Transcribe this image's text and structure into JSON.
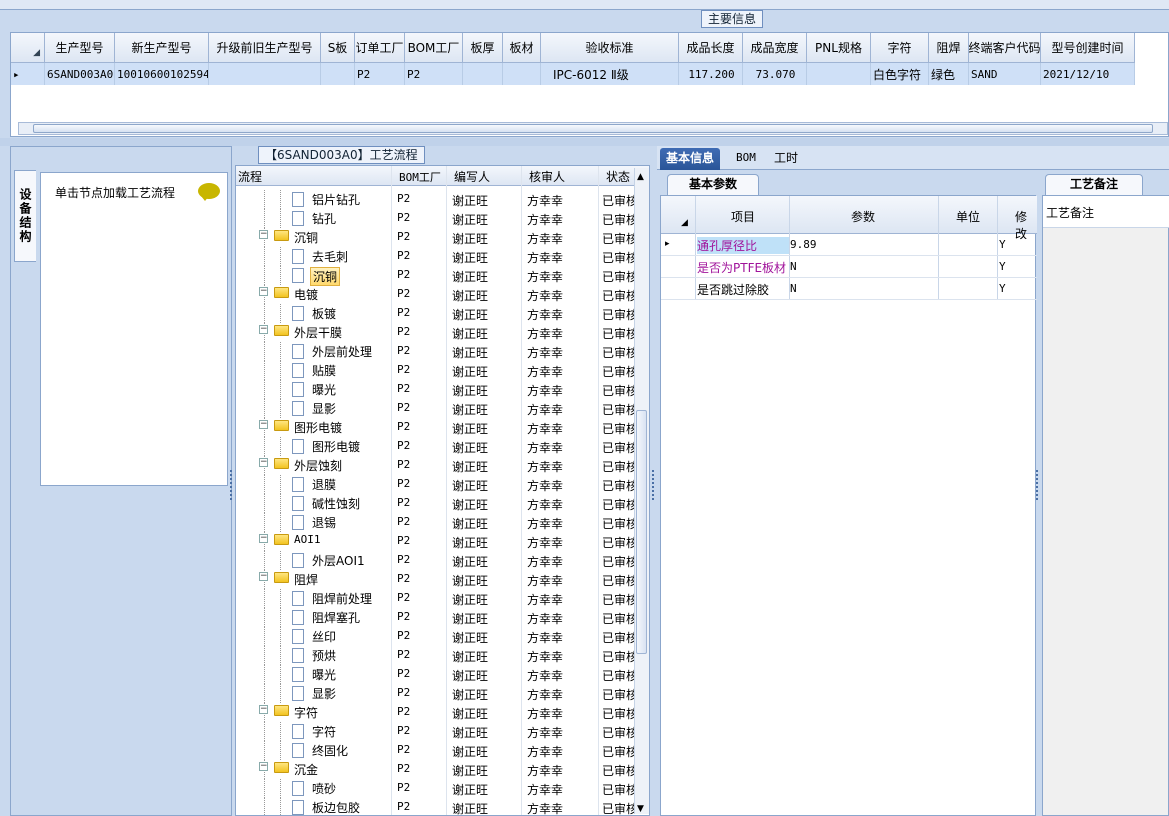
{
  "main_info": {
    "group_title": "主要信息",
    "columns": [
      "生产型号",
      "新生产型号",
      "升级前旧生产型号",
      "S板",
      "订单工厂",
      "BOM工厂",
      "板厚",
      "板材",
      "验收标准",
      "成品长度",
      "成品宽度",
      "PNL规格",
      "字符",
      "阻焊",
      "终端客户代码",
      "型号创建时间"
    ],
    "row": [
      "6SAND003A0",
      "10010600102594",
      "",
      "",
      "P2",
      "P2",
      "",
      "",
      "IPC-6012 Ⅱ级",
      "117.200",
      "73.070",
      "",
      "白色字符",
      "绿色",
      "SAND",
      "2021/12/10"
    ]
  },
  "left_panel": {
    "vertical_tab": "设备结构",
    "hint": "单击节点加载工艺流程"
  },
  "process": {
    "group_title": "【6SAND003A0】工艺流程",
    "columns": [
      "流程",
      "BOM工厂",
      "编写人",
      "核审人",
      "状态"
    ],
    "rows": [
      {
        "name": "铝片钻孔",
        "type": "doc",
        "level": 2,
        "bom": "P2",
        "writer": "谢正旺",
        "reviewer": "方幸幸",
        "status": "已审核"
      },
      {
        "name": "钻孔",
        "type": "doc",
        "level": 2,
        "bom": "P2",
        "writer": "谢正旺",
        "reviewer": "方幸幸",
        "status": "已审核"
      },
      {
        "name": "沉铜",
        "type": "folder",
        "level": 1,
        "bom": "P2",
        "writer": "谢正旺",
        "reviewer": "方幸幸",
        "status": "已审核"
      },
      {
        "name": "去毛刺",
        "type": "doc",
        "level": 2,
        "bom": "P2",
        "writer": "谢正旺",
        "reviewer": "方幸幸",
        "status": "已审核"
      },
      {
        "name": "沉铜",
        "type": "doc",
        "level": 2,
        "bom": "P2",
        "writer": "谢正旺",
        "reviewer": "方幸幸",
        "status": "已审核",
        "selected": true
      },
      {
        "name": "电镀",
        "type": "folder",
        "level": 1,
        "bom": "P2",
        "writer": "谢正旺",
        "reviewer": "方幸幸",
        "status": "已审核"
      },
      {
        "name": "板镀",
        "type": "doc",
        "level": 2,
        "bom": "P2",
        "writer": "谢正旺",
        "reviewer": "方幸幸",
        "status": "已审核"
      },
      {
        "name": "外层干膜",
        "type": "folder",
        "level": 1,
        "bom": "P2",
        "writer": "谢正旺",
        "reviewer": "方幸幸",
        "status": "已审核"
      },
      {
        "name": "外层前处理",
        "type": "doc",
        "level": 2,
        "bom": "P2",
        "writer": "谢正旺",
        "reviewer": "方幸幸",
        "status": "已审核"
      },
      {
        "name": "贴膜",
        "type": "doc",
        "level": 2,
        "bom": "P2",
        "writer": "谢正旺",
        "reviewer": "方幸幸",
        "status": "已审核"
      },
      {
        "name": "曝光",
        "type": "doc",
        "level": 2,
        "bom": "P2",
        "writer": "谢正旺",
        "reviewer": "方幸幸",
        "status": "已审核"
      },
      {
        "name": "显影",
        "type": "doc",
        "level": 2,
        "bom": "P2",
        "writer": "谢正旺",
        "reviewer": "方幸幸",
        "status": "已审核"
      },
      {
        "name": "图形电镀",
        "type": "folder",
        "level": 1,
        "bom": "P2",
        "writer": "谢正旺",
        "reviewer": "方幸幸",
        "status": "已审核"
      },
      {
        "name": "图形电镀",
        "type": "doc",
        "level": 2,
        "bom": "P2",
        "writer": "谢正旺",
        "reviewer": "方幸幸",
        "status": "已审核"
      },
      {
        "name": "外层蚀刻",
        "type": "folder",
        "level": 1,
        "bom": "P2",
        "writer": "谢正旺",
        "reviewer": "方幸幸",
        "status": "已审核"
      },
      {
        "name": "退膜",
        "type": "doc",
        "level": 2,
        "bom": "P2",
        "writer": "谢正旺",
        "reviewer": "方幸幸",
        "status": "已审核"
      },
      {
        "name": "碱性蚀刻",
        "type": "doc",
        "level": 2,
        "bom": "P2",
        "writer": "谢正旺",
        "reviewer": "方幸幸",
        "status": "已审核"
      },
      {
        "name": "退锡",
        "type": "doc",
        "level": 2,
        "bom": "P2",
        "writer": "谢正旺",
        "reviewer": "方幸幸",
        "status": "已审核"
      },
      {
        "name": "AOI1",
        "type": "folder",
        "level": 1,
        "bom": "P2",
        "writer": "谢正旺",
        "reviewer": "方幸幸",
        "status": "已审核"
      },
      {
        "name": "外层AOI1",
        "type": "doc",
        "level": 2,
        "bom": "P2",
        "writer": "谢正旺",
        "reviewer": "方幸幸",
        "status": "已审核"
      },
      {
        "name": "阻焊",
        "type": "folder",
        "level": 1,
        "bom": "P2",
        "writer": "谢正旺",
        "reviewer": "方幸幸",
        "status": "已审核"
      },
      {
        "name": "阻焊前处理",
        "type": "doc",
        "level": 2,
        "bom": "P2",
        "writer": "谢正旺",
        "reviewer": "方幸幸",
        "status": "已审核"
      },
      {
        "name": "阻焊塞孔",
        "type": "doc",
        "level": 2,
        "bom": "P2",
        "writer": "谢正旺",
        "reviewer": "方幸幸",
        "status": "已审核"
      },
      {
        "name": "丝印",
        "type": "doc",
        "level": 2,
        "bom": "P2",
        "writer": "谢正旺",
        "reviewer": "方幸幸",
        "status": "已审核"
      },
      {
        "name": "预烘",
        "type": "doc",
        "level": 2,
        "bom": "P2",
        "writer": "谢正旺",
        "reviewer": "方幸幸",
        "status": "已审核"
      },
      {
        "name": "曝光",
        "type": "doc",
        "level": 2,
        "bom": "P2",
        "writer": "谢正旺",
        "reviewer": "方幸幸",
        "status": "已审核"
      },
      {
        "name": "显影",
        "type": "doc",
        "level": 2,
        "bom": "P2",
        "writer": "谢正旺",
        "reviewer": "方幸幸",
        "status": "已审核"
      },
      {
        "name": "字符",
        "type": "folder",
        "level": 1,
        "bom": "P2",
        "writer": "谢正旺",
        "reviewer": "方幸幸",
        "status": "已审核"
      },
      {
        "name": "字符",
        "type": "doc",
        "level": 2,
        "bom": "P2",
        "writer": "谢正旺",
        "reviewer": "方幸幸",
        "status": "已审核"
      },
      {
        "name": "终固化",
        "type": "doc",
        "level": 2,
        "bom": "P2",
        "writer": "谢正旺",
        "reviewer": "方幸幸",
        "status": "已审核"
      },
      {
        "name": "沉金",
        "type": "folder",
        "level": 1,
        "bom": "P2",
        "writer": "谢正旺",
        "reviewer": "方幸幸",
        "status": "已审核"
      },
      {
        "name": "喷砂",
        "type": "doc",
        "level": 2,
        "bom": "P2",
        "writer": "谢正旺",
        "reviewer": "方幸幸",
        "status": "已审核"
      },
      {
        "name": "板边包胶",
        "type": "doc",
        "level": 2,
        "bom": "P2",
        "writer": "谢正旺",
        "reviewer": "方幸幸",
        "status": "已审核"
      }
    ]
  },
  "right_tabs": [
    "基本信息",
    "BOM",
    "工时"
  ],
  "basic_params": {
    "tab": "基本参数",
    "columns": [
      "项目",
      "参数",
      "单位",
      "修改"
    ],
    "rows": [
      {
        "item": "通孔厚径比",
        "value": "9.89",
        "unit": "",
        "modify": "Y",
        "color": "#a0139b"
      },
      {
        "item": "是否为PTFE板材",
        "value": "N",
        "unit": "",
        "modify": "Y",
        "color": "#a0139b"
      },
      {
        "item": "是否跳过除胶",
        "value": "N",
        "unit": "",
        "modify": "Y",
        "color": "#000000"
      }
    ]
  },
  "process_memo": {
    "tab": "工艺备注",
    "header": "工艺备注"
  }
}
